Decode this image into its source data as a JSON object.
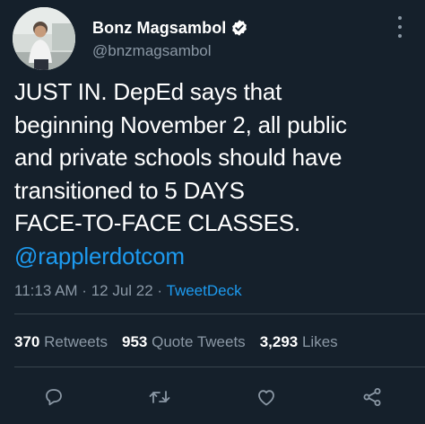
{
  "author": {
    "display_name": "Bonz Magsambol",
    "handle": "@bnzmagsambol",
    "verified": true
  },
  "tweet": {
    "lines": [
      "JUST IN. DepEd says that",
      "beginning November 2, all public",
      "and private schools should have",
      "transitioned to 5 DAYS",
      "FACE-TO-FACE CLASSES."
    ],
    "mention": "@rapplerdotcom"
  },
  "meta": {
    "time": "11:13 AM",
    "separator1": " · ",
    "date": "12 Jul 22",
    "separator2": " · ",
    "source": "TweetDeck"
  },
  "stats": {
    "retweets_count": "370",
    "retweets_label": "Retweets",
    "quotes_count": "953",
    "quotes_label": "Quote Tweets",
    "likes_count": "3,293",
    "likes_label": "Likes"
  },
  "icons": {
    "reply": "reply-icon",
    "retweet": "retweet-icon",
    "like": "heart-icon",
    "share": "share-icon",
    "more": "more-options-icon",
    "verified": "verified-badge-icon"
  },
  "colors": {
    "background": "#15202b",
    "text_primary": "#ffffff",
    "text_secondary": "#8b98a5",
    "accent": "#1d9bf0",
    "divider": "#38444d"
  }
}
